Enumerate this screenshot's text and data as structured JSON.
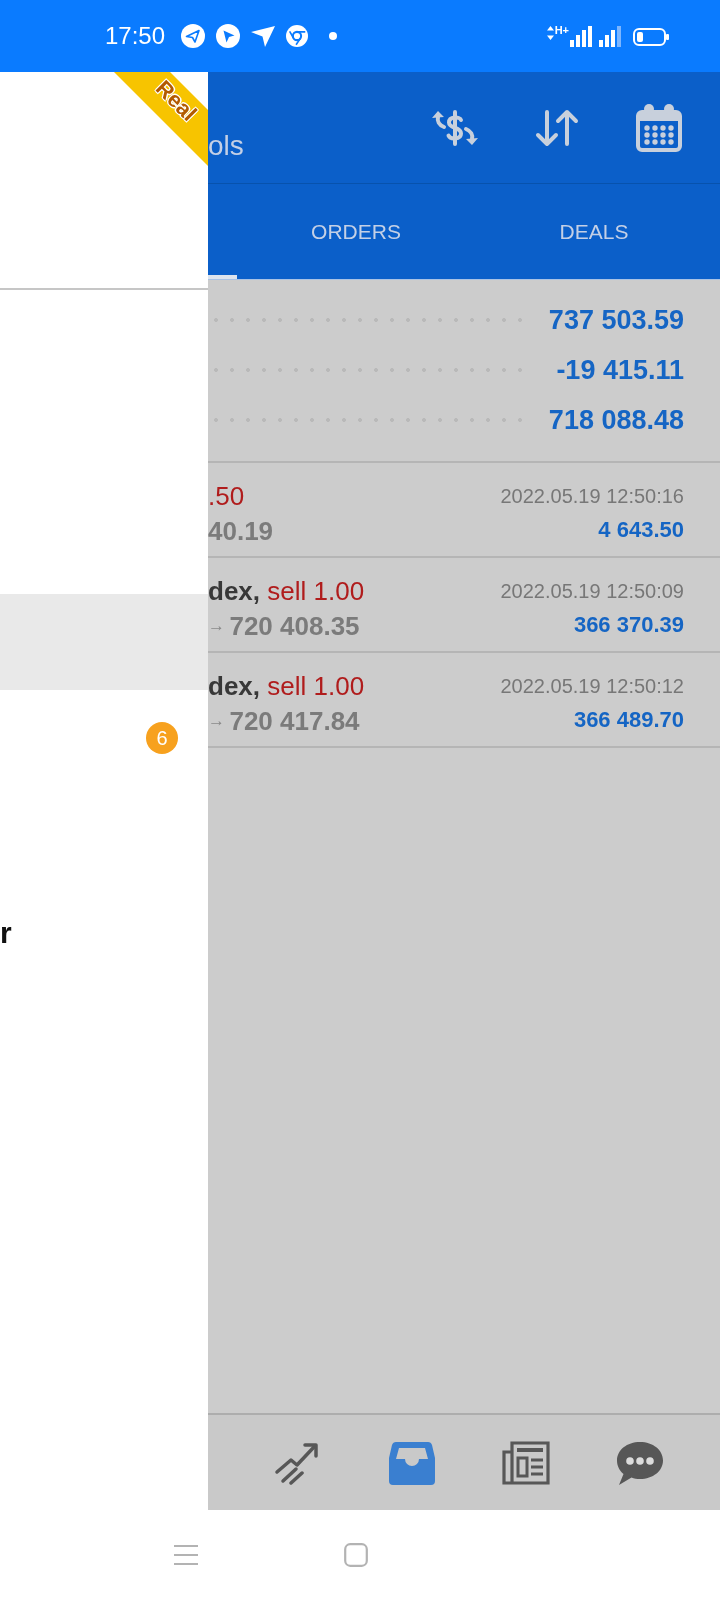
{
  "status_bar": {
    "time": "17:50",
    "network": "H+"
  },
  "drawer": {
    "ribbon": "Real",
    "menu_items": [
      {
        "selected": true
      },
      {
        "selected": false,
        "badge": "6"
      }
    ],
    "section_title": "r"
  },
  "header": {
    "title": "ols"
  },
  "tabs": [
    {
      "selected": true
    },
    {
      "label": "ORDERS",
      "selected": false
    },
    {
      "label": "DEALS",
      "selected": false
    }
  ],
  "summary": [
    {
      "value": "737 503.59"
    },
    {
      "value": "-19 415.11"
    },
    {
      "value": "718 088.48"
    }
  ],
  "deals": [
    {
      "trade": ".50",
      "price": "40.19",
      "time": "2022.05.19 12:50:16",
      "amount": "4 643.50"
    },
    {
      "symbol": "dex,",
      "trade": "sell 1.00",
      "arrow": "→",
      "price": "720 408.35",
      "time": "2022.05.19 12:50:09",
      "amount": "366 370.39"
    },
    {
      "symbol": "dex,",
      "trade": "sell 1.00",
      "arrow": "→",
      "price": "720 417.84",
      "time": "2022.05.19 12:50:12",
      "amount": "366 489.70"
    }
  ],
  "bottom_nav": [
    {
      "kind": "chart",
      "selected": false
    },
    {
      "kind": "inbox",
      "selected": true
    },
    {
      "kind": "news",
      "selected": false
    },
    {
      "kind": "chat",
      "selected": false
    }
  ]
}
